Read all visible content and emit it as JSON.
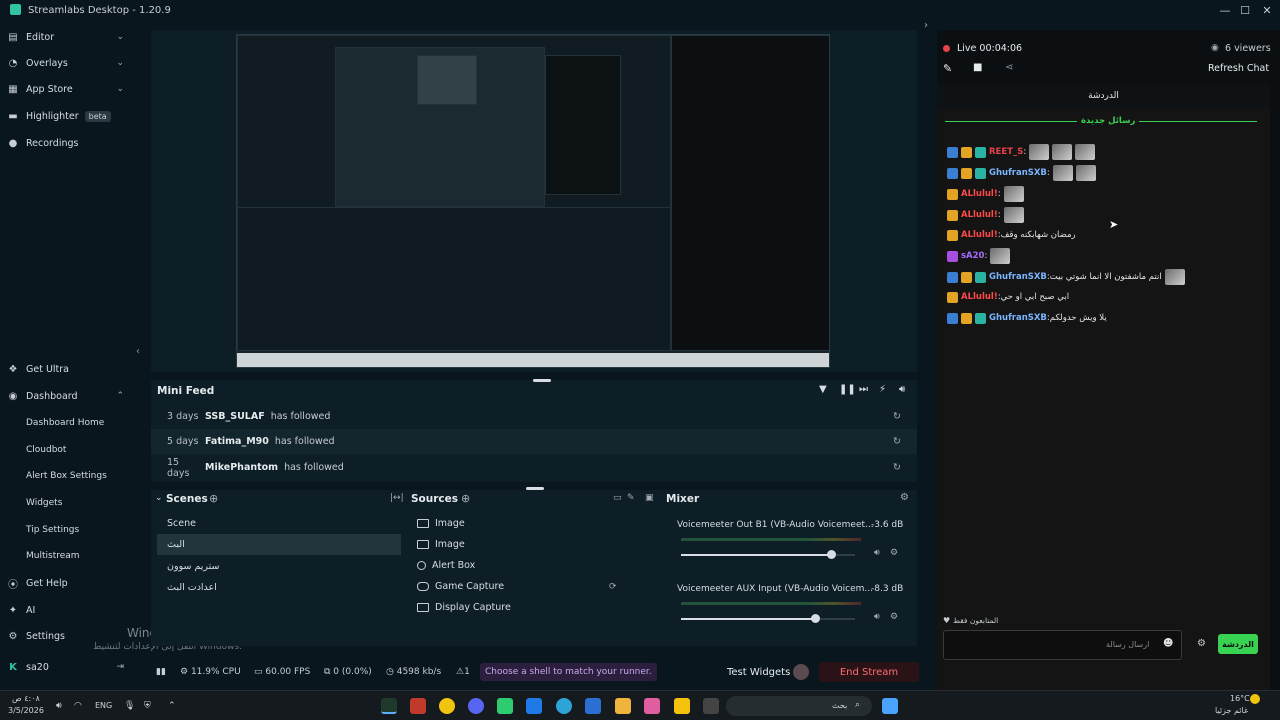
{
  "window": {
    "title": "Streamlabs Desktop - 1.20.9"
  },
  "sidebar": {
    "editor": "Editor",
    "overlays": "Overlays",
    "app_store": "App Store",
    "highlighter": "Highlighter",
    "highlighter_badge": "beta",
    "recordings": "Recordings",
    "get_ultra": "Get Ultra",
    "dashboard": "Dashboard",
    "dashboard_home": "Dashboard Home",
    "cloudbot": "Cloudbot",
    "alert_box_settings": "Alert Box Settings",
    "widgets": "Widgets",
    "tip_settings": "Tip Settings",
    "multistream": "Multistream",
    "get_help": "Get Help",
    "ai": "AI",
    "settings": "Settings",
    "user": "sa20"
  },
  "watermark": {
    "line1": "Windows تنشيط",
    "line2": "انتقل إلى الإعدادات لتنشيط Windows."
  },
  "minifeed": {
    "title": "Mini Feed",
    "rows": [
      {
        "days": "3 days",
        "user": "SSB_SULAF",
        "action": "has followed"
      },
      {
        "days": "5 days",
        "user": "Fatima_M90",
        "action": "has followed"
      },
      {
        "days": "15 days",
        "user": "MikePhantom",
        "action": "has followed"
      }
    ]
  },
  "scenes": {
    "title": "Scenes",
    "items": [
      "Scene",
      "البث",
      "ستريم سوون",
      "اعدادت البث"
    ],
    "selected": 1
  },
  "sources": {
    "title": "Sources",
    "items": [
      "Image",
      "Image",
      "Alert Box",
      "Game Capture",
      "Display Capture"
    ]
  },
  "mixer": {
    "title": "Mixer",
    "channels": [
      {
        "name": "Voicemeeter Out B1 (VB-Audio Voicemeet...",
        "db": "-3.6 dB",
        "level": 0.86
      },
      {
        "name": "Voicemeeter AUX Input (VB-Audio Voicem...",
        "db": "-8.3 dB",
        "level": 0.77
      }
    ]
  },
  "status": {
    "cpu": "11.9% CPU",
    "fps": "60.00 FPS",
    "dropped": "0 (0.0%)",
    "bitrate": "4598 kb/s",
    "warnings": "1",
    "notice": "Choose a shell to match your runner.",
    "test_widgets": "Test Widgets",
    "end_stream": "End Stream"
  },
  "chat": {
    "live": "Live 00:04:06",
    "viewers": "6 viewers",
    "refresh": "Refresh Chat",
    "tab": "الدردشة",
    "new_messages": "رسائل جديدة",
    "messages": [
      {
        "user": "REET_S",
        "color": "#e8424a",
        "text": "",
        "badges": [
          "blue",
          "gold",
          "teal"
        ],
        "emotes": 3
      },
      {
        "user": "GhufranSXB",
        "color": "#7ab7ff",
        "text": "",
        "badges": [
          "blue",
          "gold",
          "teal"
        ],
        "emotes": 2
      },
      {
        "user": "ALlulul!",
        "color": "#ff4a4a",
        "text": "",
        "badges": [
          "gold"
        ],
        "emotes": 1
      },
      {
        "user": "ALlulul!",
        "color": "#ff4a4a",
        "text": "",
        "badges": [
          "gold"
        ],
        "emotes": 1
      },
      {
        "user": "ALlulul!",
        "color": "#ff4a4a",
        "text": "رمضان شهابكنه وقف",
        "badges": [
          "gold"
        ],
        "emotes": 0
      },
      {
        "user": "sA20",
        "color": "#a86bff",
        "text": "",
        "badges": [
          "purple"
        ],
        "emotes": 1
      },
      {
        "user": "GhufranSXB",
        "color": "#7ab7ff",
        "text": "انتم ماشفتون الا انما شوتي بيت",
        "badges": [
          "blue",
          "gold",
          "teal"
        ],
        "emotes": 1
      },
      {
        "user": "ALlulul!",
        "color": "#ff4a4a",
        "text": "ابي صبح ابي او حي",
        "badges": [
          "gold"
        ],
        "emotes": 0
      },
      {
        "user": "GhufranSXB",
        "color": "#7ab7ff",
        "text": "يلا ويش حدولكم",
        "badges": [
          "blue",
          "gold",
          "teal"
        ],
        "emotes": 0
      }
    ],
    "viewers_label": "المتابعون فقط",
    "input_placeholder": "ارسال رسالة",
    "send": "الدردشة"
  },
  "taskbar": {
    "time": "٤:٠٨ ص",
    "date": "3/5/2026",
    "lang": "ENG",
    "search": "بحث",
    "temp": "16°C",
    "weather": "غائم جزئيا"
  }
}
